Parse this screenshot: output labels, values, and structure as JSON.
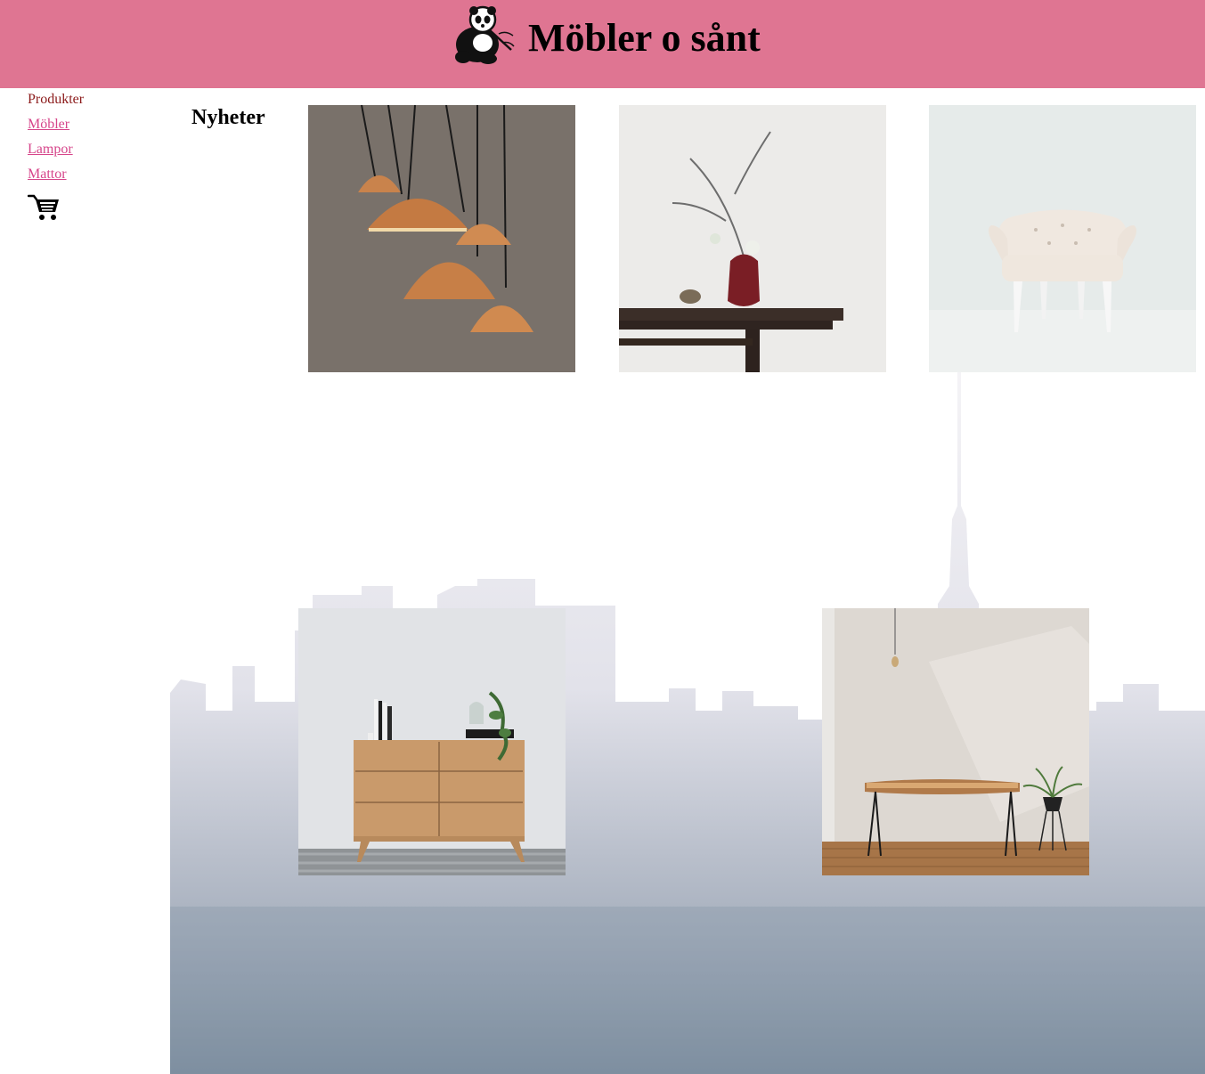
{
  "site": {
    "title": "Möbler o sånt",
    "header_color": "#df7592",
    "logo_icon": "panda-icon"
  },
  "nav": {
    "heading": "Produkter",
    "links": [
      {
        "label": "Möbler"
      },
      {
        "label": "Lampor"
      },
      {
        "label": "Mattor"
      }
    ],
    "cart_icon": "shopping-cart-icon",
    "link_color": "#d6458a",
    "heading_color": "#8b1a1a"
  },
  "main": {
    "section_title": "Nyheter",
    "products": [
      {
        "image": "copper-pendant-lamps"
      },
      {
        "image": "vase-on-wooden-bench"
      },
      {
        "image": "white-tufted-armchair"
      },
      {
        "image": "oak-dresser"
      },
      {
        "image": "live-edge-console-table"
      }
    ]
  }
}
